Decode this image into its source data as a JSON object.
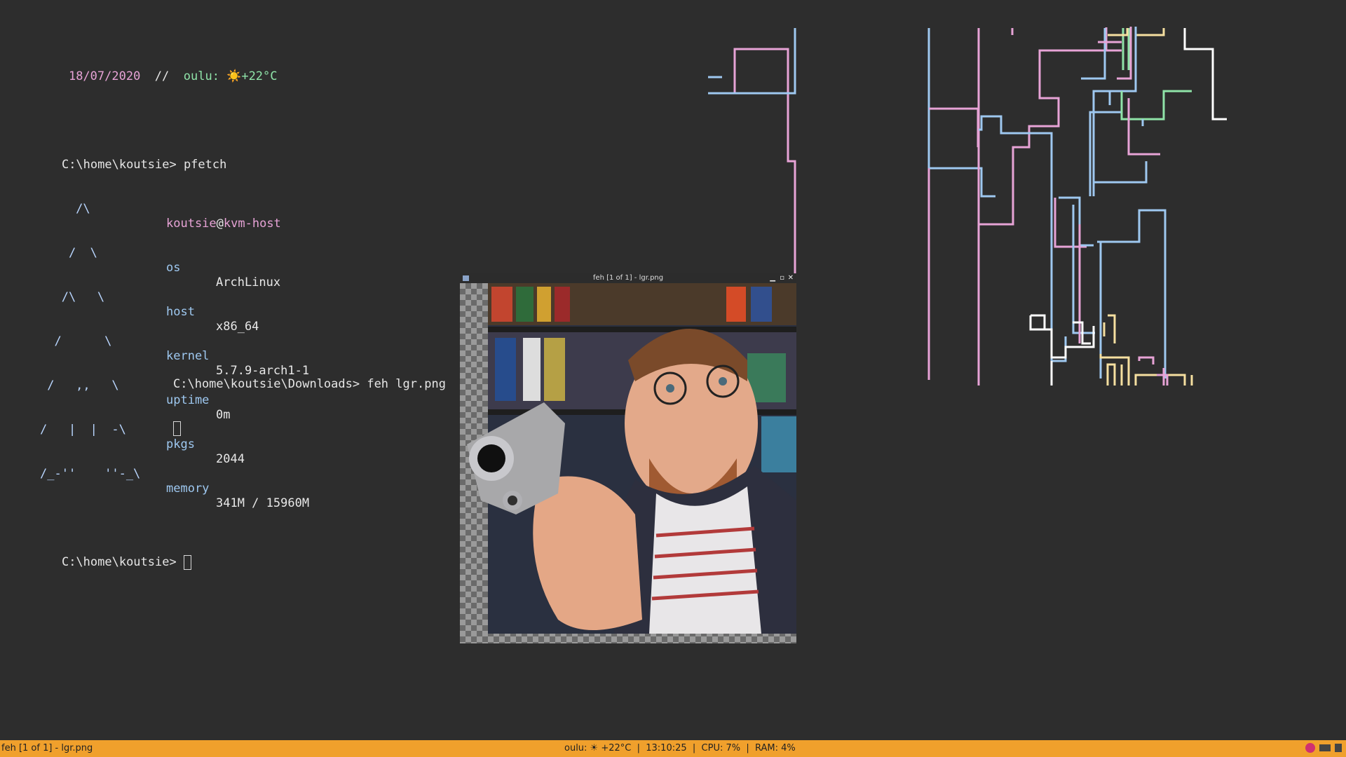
{
  "top_line": {
    "date": "18/07/2020",
    "sep": "//",
    "weather": "oulu: ☀️+22°C"
  },
  "terminal1": {
    "prompt1": "C:\\home\\koutsie> pfetch",
    "user": "koutsie",
    "at": "@",
    "host": "kvm-host",
    "logo": [
      "     /\\",
      "    /  \\",
      "   /\\   \\",
      "  /      \\",
      " /   ,,   \\",
      "/   |  |  -\\",
      "/_-''    ''-_\\"
    ],
    "fields": [
      {
        "key": "os",
        "value": "ArchLinux"
      },
      {
        "key": "host",
        "value": "x86_64"
      },
      {
        "key": "kernel",
        "value": "5.7.9-arch1-1"
      },
      {
        "key": "uptime",
        "value": "0m"
      },
      {
        "key": "pkgs",
        "value": "2044"
      },
      {
        "key": "memory",
        "value": "341M / 15960M"
      }
    ],
    "prompt2": "C:\\home\\koutsie> "
  },
  "terminal2": {
    "prompt": "C:\\home\\koutsie\\Downloads> feh lgr.png"
  },
  "feh_window": {
    "title": "feh [1 of 1] - lgr.png",
    "controls": "_ ▫ ✕"
  },
  "statusbar": {
    "left": "feh [1 of 1] - lgr.png",
    "center": "oulu: ☀ +22°C  |  13:10:25  |  CPU: 7%  |  RAM: 4%"
  },
  "colors": {
    "bar": "#f0a02c",
    "background": "#2d2d2d",
    "pink": "#e7a3d6",
    "green": "#8fe3a8",
    "blue": "#9ec8f0"
  }
}
